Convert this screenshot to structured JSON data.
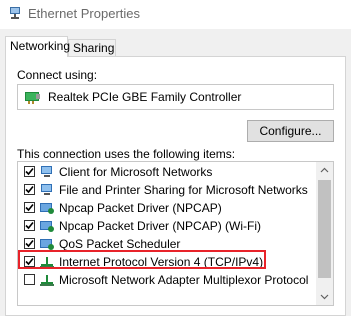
{
  "window": {
    "title": "Ethernet Properties",
    "icon": "network-adapter-icon"
  },
  "tabs": [
    {
      "label": "Networking",
      "active": true
    },
    {
      "label": "Sharing",
      "active": false
    }
  ],
  "connect_using": {
    "label": "Connect using:",
    "adapter_name": "Realtek PCIe GBE Family Controller",
    "adapter_icon": "network-adapter-icon"
  },
  "configure_button": "Configure...",
  "items_label": "This connection uses the following items:",
  "items": [
    {
      "label": "Client for Microsoft Networks",
      "checked": true,
      "icon": "network-client-icon"
    },
    {
      "label": "File and Printer Sharing for Microsoft Networks",
      "checked": true,
      "icon": "network-client-icon"
    },
    {
      "label": "Npcap Packet Driver (NPCAP)",
      "checked": true,
      "icon": "network-service-icon"
    },
    {
      "label": "Npcap Packet Driver (NPCAP) (Wi-Fi)",
      "checked": true,
      "icon": "network-service-icon"
    },
    {
      "label": "QoS Packet Scheduler",
      "checked": true,
      "icon": "network-service-icon"
    },
    {
      "label": "Internet Protocol Version 4 (TCP/IPv4)",
      "checked": true,
      "icon": "protocol-icon",
      "highlighted": true
    },
    {
      "label": "Microsoft Network Adapter Multiplexor Protocol",
      "checked": false,
      "icon": "protocol-icon"
    }
  ],
  "colors": {
    "highlight_border": "#e8232a",
    "icon_green": "#1f8a3a",
    "icon_blue": "#2f6fb5"
  }
}
